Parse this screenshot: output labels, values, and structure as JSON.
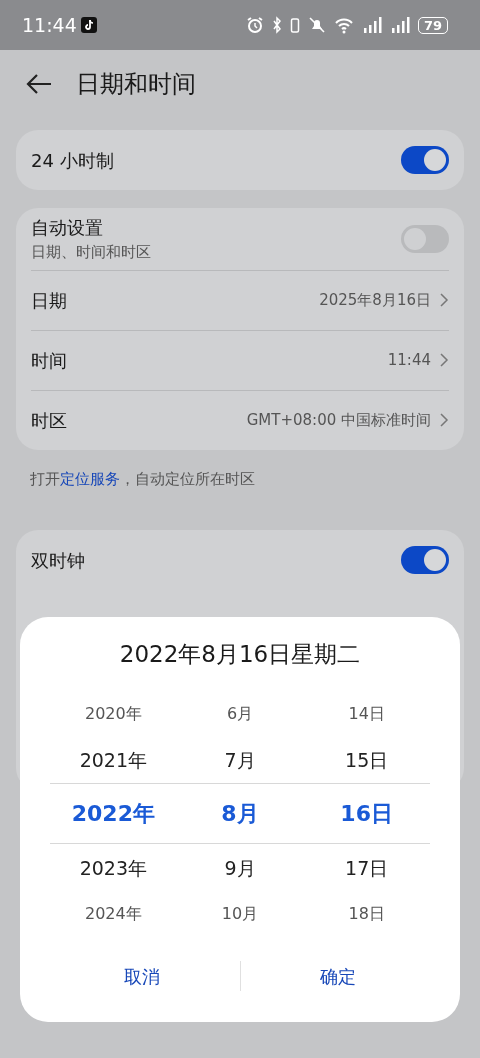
{
  "status_bar": {
    "time": "11:44",
    "battery": "79"
  },
  "header": {
    "title": "日期和时间"
  },
  "sections": [
    {
      "items": [
        {
          "kind": "toggle",
          "label": "24 小时制",
          "on": true
        }
      ]
    },
    {
      "items": [
        {
          "kind": "toggle",
          "label": "自动设置",
          "subtitle": "日期、时间和时区",
          "on": false
        },
        {
          "kind": "link",
          "label": "日期",
          "value": "2025年8月16日"
        },
        {
          "kind": "link",
          "label": "时间",
          "value": "11:44"
        },
        {
          "kind": "link",
          "label": "时区",
          "value": "GMT+08:00 中国标准时间"
        }
      ],
      "footnote": {
        "before": "打开",
        "link": "定位服务",
        "after": "，自动定位所在时区"
      }
    },
    {
      "items": [
        {
          "kind": "toggle",
          "label": "双时钟",
          "on": true
        }
      ]
    }
  ],
  "dialog": {
    "title": "2022年8月16日星期二",
    "columns": [
      {
        "items": [
          {
            "label": "2020年",
            "selected": false
          },
          {
            "label": "2021年",
            "selected": false
          },
          {
            "label": "2022年",
            "selected": true
          },
          {
            "label": "2023年",
            "selected": false
          },
          {
            "label": "2024年",
            "selected": false
          }
        ]
      },
      {
        "items": [
          {
            "label": "6月",
            "selected": false
          },
          {
            "label": "7月",
            "selected": false
          },
          {
            "label": "8月",
            "selected": true
          },
          {
            "label": "9月",
            "selected": false
          },
          {
            "label": "10月",
            "selected": false
          }
        ]
      },
      {
        "items": [
          {
            "label": "14日",
            "selected": false
          },
          {
            "label": "15日",
            "selected": false
          },
          {
            "label": "16日",
            "selected": true
          },
          {
            "label": "17日",
            "selected": false
          },
          {
            "label": "18日",
            "selected": false
          }
        ]
      }
    ],
    "buttons": [
      "取消",
      "确定"
    ]
  }
}
